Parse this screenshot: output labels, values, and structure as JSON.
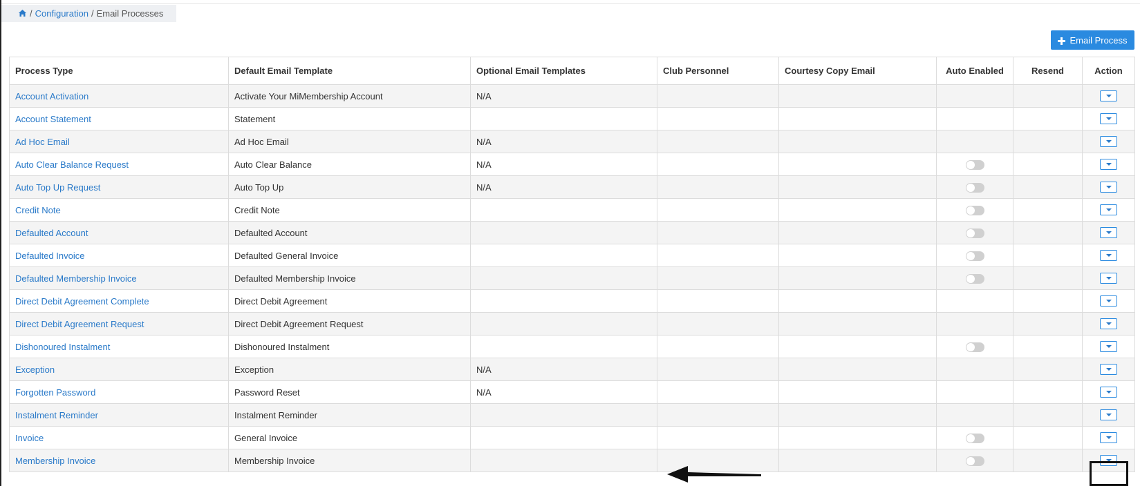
{
  "breadcrumb": {
    "home_icon": "home-icon",
    "separator": "/",
    "items": [
      "Configuration",
      "Email Processes"
    ]
  },
  "toolbar": {
    "add_label": "Email Process",
    "add_icon": "plus-icon",
    "accent": "#2a8ae0"
  },
  "table": {
    "columns": [
      "Process Type",
      "Default Email Template",
      "Optional Email Templates",
      "Club Personnel",
      "Courtesy Copy Email",
      "Auto Enabled",
      "Resend",
      "Action"
    ],
    "rows": [
      {
        "process": "Account Activation",
        "template": "Activate Your MiMembership Account",
        "optional": "N/A",
        "auto_toggle": false
      },
      {
        "process": "Account Statement",
        "template": "Statement",
        "optional": "",
        "auto_toggle": false
      },
      {
        "process": "Ad Hoc Email",
        "template": "Ad Hoc Email",
        "optional": "N/A",
        "auto_toggle": false
      },
      {
        "process": "Auto Clear Balance Request",
        "template": "Auto Clear Balance",
        "optional": "N/A",
        "auto_toggle": true
      },
      {
        "process": "Auto Top Up Request",
        "template": "Auto Top Up",
        "optional": "N/A",
        "auto_toggle": true
      },
      {
        "process": "Credit Note",
        "template": "Credit Note",
        "optional": "",
        "auto_toggle": true
      },
      {
        "process": "Defaulted Account",
        "template": "Defaulted Account",
        "optional": "",
        "auto_toggle": true
      },
      {
        "process": "Defaulted Invoice",
        "template": "Defaulted General Invoice",
        "optional": "",
        "auto_toggle": true
      },
      {
        "process": "Defaulted Membership Invoice",
        "template": "Defaulted Membership Invoice",
        "optional": "",
        "auto_toggle": true
      },
      {
        "process": "Direct Debit Agreement Complete",
        "template": "Direct Debit Agreement",
        "optional": "",
        "auto_toggle": false
      },
      {
        "process": "Direct Debit Agreement Request",
        "template": "Direct Debit Agreement Request",
        "optional": "",
        "auto_toggle": false
      },
      {
        "process": "Dishonoured Instalment",
        "template": "Dishonoured Instalment",
        "optional": "",
        "auto_toggle": true
      },
      {
        "process": "Exception",
        "template": "Exception",
        "optional": "N/A",
        "auto_toggle": false
      },
      {
        "process": "Forgotten Password",
        "template": "Password Reset",
        "optional": "N/A",
        "auto_toggle": false
      },
      {
        "process": "Instalment Reminder",
        "template": "Instalment Reminder",
        "optional": "",
        "auto_toggle": false
      },
      {
        "process": "Invoice",
        "template": "General Invoice",
        "optional": "",
        "auto_toggle": true
      },
      {
        "process": "Membership Invoice",
        "template": "Membership Invoice",
        "optional": "",
        "auto_toggle": true
      }
    ]
  },
  "annotation": {
    "highlight_row": "Membership Invoice"
  }
}
